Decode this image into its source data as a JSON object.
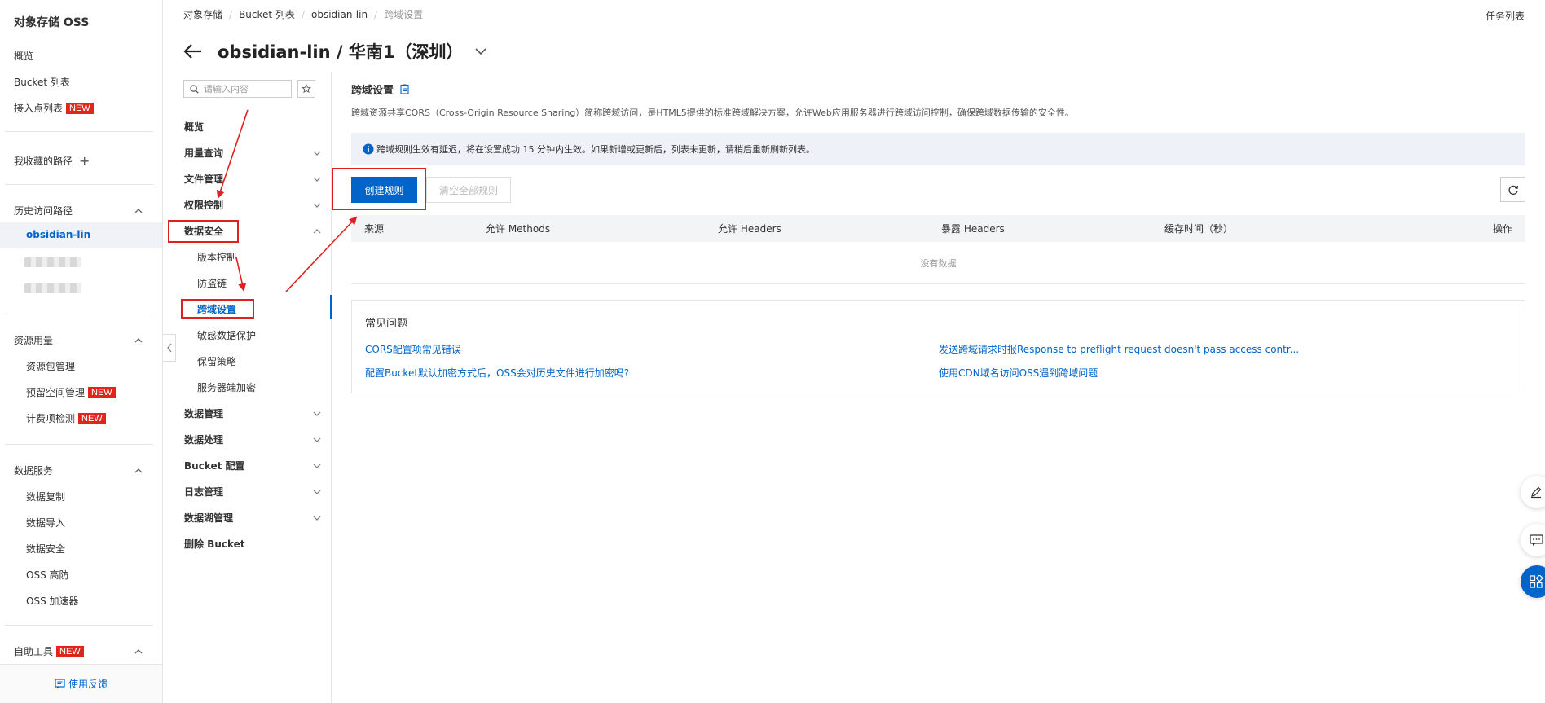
{
  "left_nav": {
    "title": "对象存储 OSS",
    "items": [
      {
        "label": "概览"
      },
      {
        "label": "Bucket 列表"
      },
      {
        "label": "接入点列表",
        "badge": "NEW"
      }
    ],
    "favorites": {
      "label": "我收藏的路径",
      "add_symbol": "+"
    },
    "history": {
      "label": "历史访问路径",
      "active_item": "obsidian-lin"
    },
    "resource": {
      "label": "资源用量",
      "items": [
        {
          "label": "资源包管理"
        },
        {
          "label": "预留空间管理",
          "badge": "NEW"
        },
        {
          "label": "计费项检测",
          "badge": "NEW"
        }
      ]
    },
    "data_service": {
      "label": "数据服务",
      "items": [
        {
          "label": "数据复制"
        },
        {
          "label": "数据导入"
        },
        {
          "label": "数据安全"
        },
        {
          "label": "OSS 高防"
        },
        {
          "label": "OSS 加速器"
        }
      ]
    },
    "self_tools": {
      "label": "自助工具",
      "badge": "NEW"
    },
    "feedback": "使用反馈"
  },
  "breadcrumb": [
    "对象存储",
    "Bucket 列表",
    "obsidian-lin",
    "跨域设置"
  ],
  "task_list": "任务列表",
  "page_title": "obsidian-lin / 华南1（深圳）",
  "bucket_nav": {
    "search_placeholder": "请输入内容",
    "items": [
      {
        "label": "概览"
      },
      {
        "label": "用量查询"
      },
      {
        "label": "文件管理"
      },
      {
        "label": "权限控制"
      },
      {
        "label": "数据安全"
      },
      {
        "label": "数据管理"
      },
      {
        "label": "数据处理"
      },
      {
        "label": "Bucket 配置"
      },
      {
        "label": "日志管理"
      },
      {
        "label": "数据湖管理"
      },
      {
        "label": "删除 Bucket"
      }
    ],
    "data_security_sub": [
      "版本控制",
      "防盗链",
      "跨域设置",
      "敏感数据保护",
      "保留策略",
      "服务器端加密"
    ]
  },
  "main": {
    "section_title": "跨域设置",
    "description": "跨域资源共享CORS（Cross-Origin Resource Sharing）简称跨域访问，是HTML5提供的标准跨域解决方案，允许Web应用服务器进行跨域访问控制，确保跨域数据传输的安全性。",
    "notice": "跨域规则生效有延迟，将在设置成功 15 分钟内生效。如果新增或更新后，列表未更新，请稍后重新刷新列表。",
    "create_button": "创建规则",
    "clear_button": "清空全部规则",
    "table": {
      "columns": [
        "来源",
        "允许 Methods",
        "允许 Headers",
        "暴露 Headers",
        "缓存时间（秒）",
        "操作"
      ],
      "empty_text": "没有数据"
    },
    "faq": {
      "title": "常见问题",
      "links": [
        "CORS配置项常见错误",
        "发送跨域请求时报Response to preflight request doesn't pass access contr...",
        "配置Bucket默认加密方式后，OSS会对历史文件进行加密吗?",
        "使用CDN域名访问OSS遇到跨域问题"
      ]
    }
  },
  "colors": {
    "primary": "#0064c8",
    "annotation_red": "#e02020",
    "badge_red": "#e1251b"
  }
}
